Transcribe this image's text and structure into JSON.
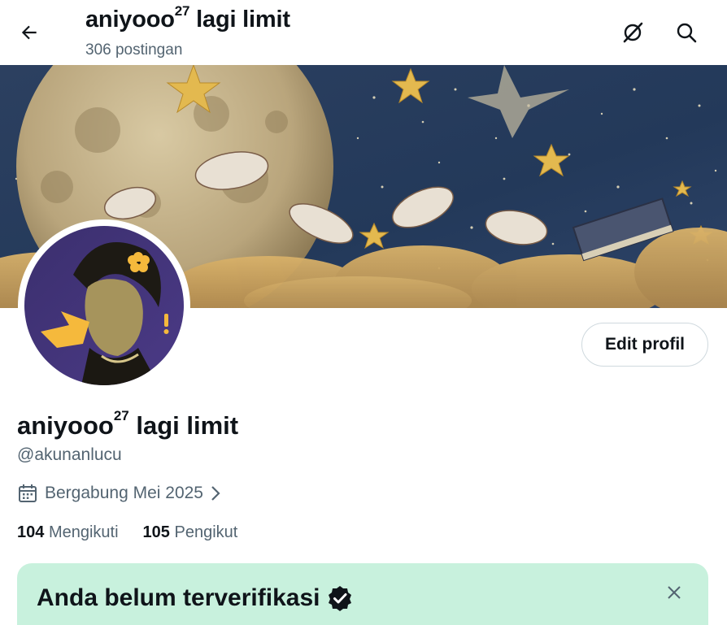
{
  "header": {
    "title_main": "aniyooo",
    "title_sup": "27",
    "title_rest": " lagi limit",
    "post_count": "306 postingan"
  },
  "icons": {
    "back": "arrow-left-icon",
    "grok": "grok-icon",
    "search": "search-icon",
    "calendar": "calendar-icon",
    "chevron": "chevron-right-icon",
    "close": "close-icon",
    "verified": "verified-badge-icon"
  },
  "profile": {
    "name_main": "aniyooo",
    "name_sup": "27",
    "name_rest": " lagi limit",
    "handle": "@akunanlucu",
    "joined": "Bergabung Mei 2025",
    "edit_label": "Edit profil",
    "following_count": "104",
    "following_label": "Mengikuti",
    "followers_count": "105",
    "followers_label": "Pengikut"
  },
  "verify_card": {
    "title": "Anda belum terverifikasi"
  },
  "colors": {
    "text_primary": "#0f1419",
    "text_secondary": "#536471",
    "verify_bg": "#c8f1dd",
    "border": "#cfd9de"
  }
}
